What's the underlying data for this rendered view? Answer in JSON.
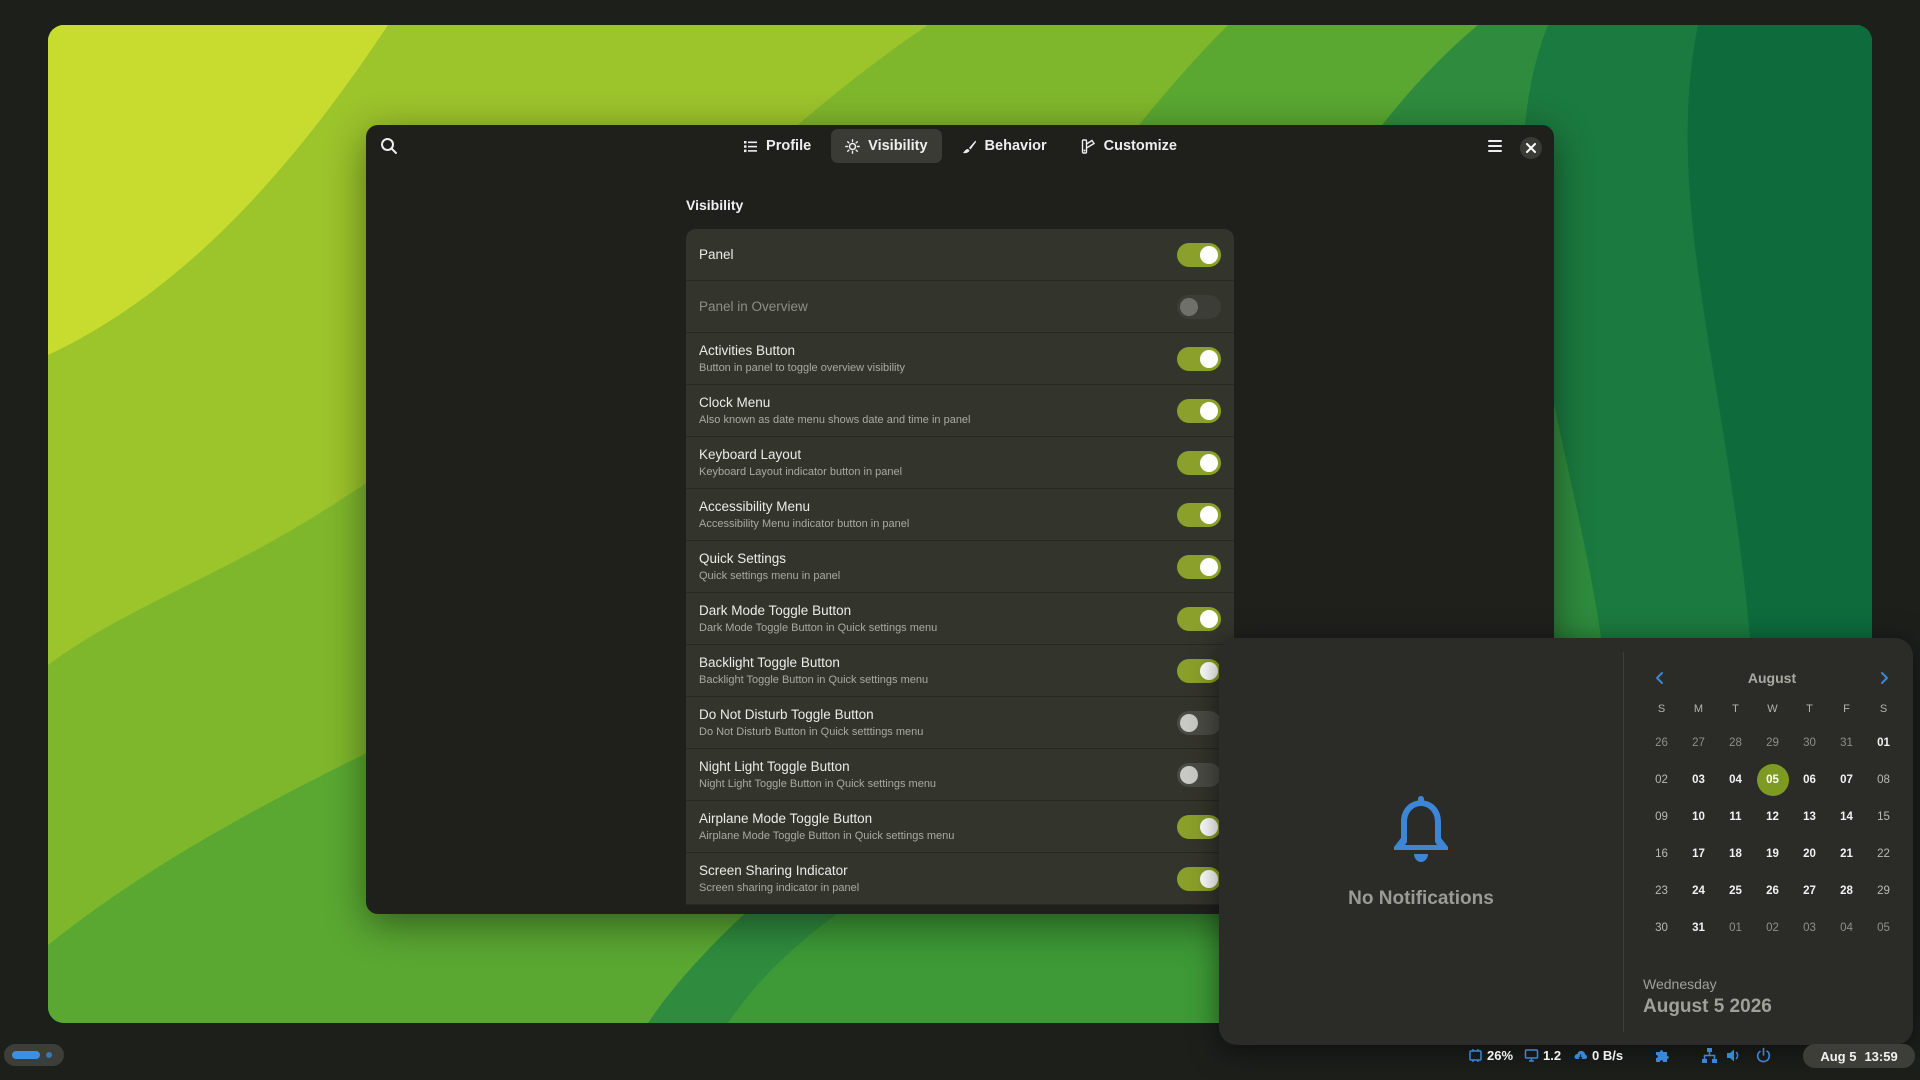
{
  "window": {
    "tabs": [
      {
        "label": "Profile",
        "icon": "list-icon"
      },
      {
        "label": "Visibility",
        "icon": "sun-icon",
        "active": true
      },
      {
        "label": "Behavior",
        "icon": "brush-icon"
      },
      {
        "label": "Customize",
        "icon": "palette-icon"
      }
    ],
    "section_title": "Visibility",
    "rows": [
      {
        "title": "Panel",
        "subtitle": "",
        "state": "on"
      },
      {
        "title": "Panel in Overview",
        "subtitle": "",
        "state": "disabled"
      },
      {
        "title": "Activities Button",
        "subtitle": "Button in panel to toggle overview visibility",
        "state": "on"
      },
      {
        "title": "Clock Menu",
        "subtitle": "Also known as date menu shows date and time in panel",
        "state": "on"
      },
      {
        "title": "Keyboard Layout",
        "subtitle": "Keyboard Layout indicator button in panel",
        "state": "on"
      },
      {
        "title": "Accessibility Menu",
        "subtitle": "Accessibility Menu indicator button in panel",
        "state": "on"
      },
      {
        "title": "Quick Settings",
        "subtitle": "Quick settings menu in panel",
        "state": "on"
      },
      {
        "title": "Dark Mode Toggle Button",
        "subtitle": "Dark Mode Toggle Button in Quick settings menu",
        "state": "on"
      },
      {
        "title": "Backlight Toggle Button",
        "subtitle": "Backlight Toggle Button in Quick settings menu",
        "state": "on"
      },
      {
        "title": "Do Not Disturb Toggle Button",
        "subtitle": "Do Not Disturb Button in Quick setttings menu",
        "state": "off"
      },
      {
        "title": "Night Light Toggle Button",
        "subtitle": "Night Light Toggle Button in Quick settings menu",
        "state": "off"
      },
      {
        "title": "Airplane Mode Toggle Button",
        "subtitle": "Airplane Mode Toggle Button in Quick settings menu",
        "state": "on"
      },
      {
        "title": "Screen Sharing Indicator",
        "subtitle": "Screen sharing indicator in panel",
        "state": "on"
      }
    ]
  },
  "popover": {
    "notifications_text": "No Notifications",
    "calendar": {
      "month": "August",
      "weekdays": [
        "S",
        "M",
        "T",
        "W",
        "T",
        "F",
        "S"
      ],
      "days": [
        {
          "d": "26",
          "kind": "muted"
        },
        {
          "d": "27",
          "kind": "muted"
        },
        {
          "d": "28",
          "kind": "muted"
        },
        {
          "d": "29",
          "kind": "muted"
        },
        {
          "d": "30",
          "kind": "muted"
        },
        {
          "d": "31",
          "kind": "muted"
        },
        {
          "d": "01",
          "kind": "normal"
        },
        {
          "d": "02",
          "kind": "weekend"
        },
        {
          "d": "03",
          "kind": "normal"
        },
        {
          "d": "04",
          "kind": "normal"
        },
        {
          "d": "05",
          "kind": "today"
        },
        {
          "d": "06",
          "kind": "normal"
        },
        {
          "d": "07",
          "kind": "normal"
        },
        {
          "d": "08",
          "kind": "weekend"
        },
        {
          "d": "09",
          "kind": "weekend"
        },
        {
          "d": "10",
          "kind": "normal"
        },
        {
          "d": "11",
          "kind": "normal"
        },
        {
          "d": "12",
          "kind": "normal"
        },
        {
          "d": "13",
          "kind": "normal"
        },
        {
          "d": "14",
          "kind": "normal"
        },
        {
          "d": "15",
          "kind": "weekend"
        },
        {
          "d": "16",
          "kind": "weekend"
        },
        {
          "d": "17",
          "kind": "normal"
        },
        {
          "d": "18",
          "kind": "normal"
        },
        {
          "d": "19",
          "kind": "normal"
        },
        {
          "d": "20",
          "kind": "normal"
        },
        {
          "d": "21",
          "kind": "normal"
        },
        {
          "d": "22",
          "kind": "weekend"
        },
        {
          "d": "23",
          "kind": "weekend"
        },
        {
          "d": "24",
          "kind": "normal"
        },
        {
          "d": "25",
          "kind": "normal"
        },
        {
          "d": "26",
          "kind": "normal"
        },
        {
          "d": "27",
          "kind": "normal"
        },
        {
          "d": "28",
          "kind": "normal"
        },
        {
          "d": "29",
          "kind": "weekend"
        },
        {
          "d": "30",
          "kind": "weekend"
        },
        {
          "d": "31",
          "kind": "normal"
        },
        {
          "d": "01",
          "kind": "muted"
        },
        {
          "d": "02",
          "kind": "muted"
        },
        {
          "d": "03",
          "kind": "muted"
        },
        {
          "d": "04",
          "kind": "muted"
        },
        {
          "d": "05",
          "kind": "muted"
        }
      ],
      "weekday_label": "Wednesday",
      "full_date": "August 5 2026"
    }
  },
  "panel": {
    "cpu": "26%",
    "load": "1.2",
    "net": "0 B/s",
    "clock_date": "Aug 5",
    "clock_time": "13:59",
    "accent_color": "#3d8fe4"
  },
  "colors": {
    "switch_on": "#8aa02a",
    "today": "#7e9a22"
  }
}
